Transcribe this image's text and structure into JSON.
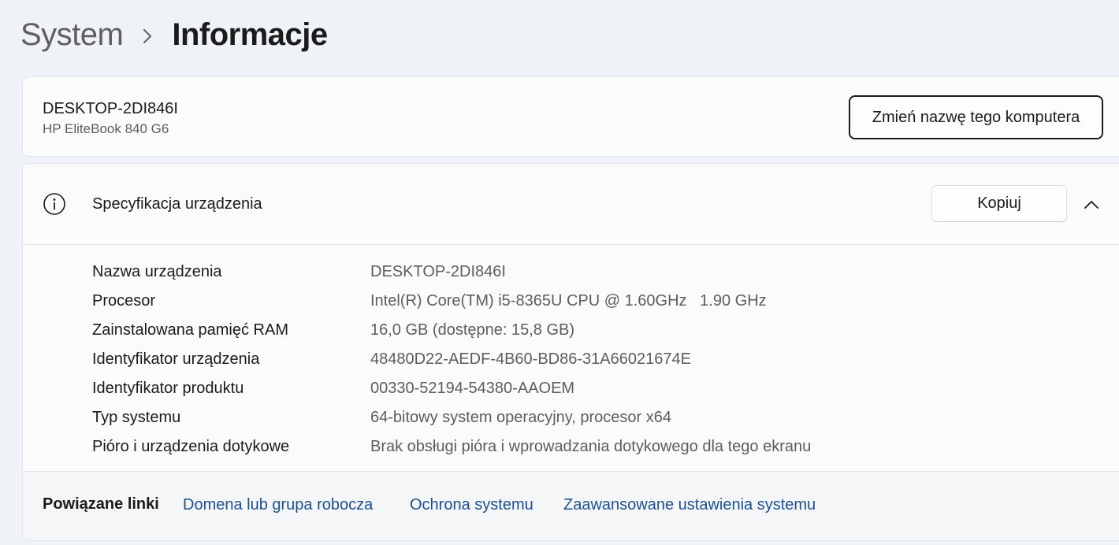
{
  "breadcrumb": {
    "parent": "System",
    "current": "Informacje"
  },
  "device": {
    "name": "DESKTOP-2DI846I",
    "model": "HP EliteBook 840 G6",
    "rename_button": "Zmień nazwę tego komputera"
  },
  "specs": {
    "title": "Specyfikacja urządzenia",
    "copy_button": "Kopiuj",
    "rows": [
      {
        "label": "Nazwa urządzenia",
        "value": "DESKTOP-2DI846I"
      },
      {
        "label": "Procesor",
        "value": "Intel(R) Core(TM) i5-8365U CPU @ 1.60GHz   1.90 GHz"
      },
      {
        "label": "Zainstalowana pamięć RAM",
        "value": "16,0 GB (dostępne: 15,8 GB)"
      },
      {
        "label": "Identyfikator urządzenia",
        "value": "48480D22-AEDF-4B60-BD86-31A66021674E"
      },
      {
        "label": "Identyfikator produktu",
        "value": "00330-52194-54380-AAOEM"
      },
      {
        "label": "Typ systemu",
        "value": "64-bitowy system operacyjny, procesor x64"
      },
      {
        "label": "Pióro i urządzenia dotykowe",
        "value": "Brak obsługi pióra i wprowadzania dotykowego dla tego ekranu"
      }
    ]
  },
  "related": {
    "label": "Powiązane linki",
    "links": [
      {
        "label": "Domena lub grupa robocza"
      },
      {
        "label": "Ochrona systemu"
      },
      {
        "label": "Zaawansowane ustawienia systemu"
      }
    ]
  },
  "colors": {
    "background": "#eff3f8",
    "card": "#fbfbfb",
    "link": "#1d4f91",
    "secondary_text": "#5d5d5d"
  },
  "icons": {
    "breadcrumb_separator": "chevron-right-icon",
    "spec_header": "info-icon",
    "collapse": "chevron-up-icon"
  }
}
